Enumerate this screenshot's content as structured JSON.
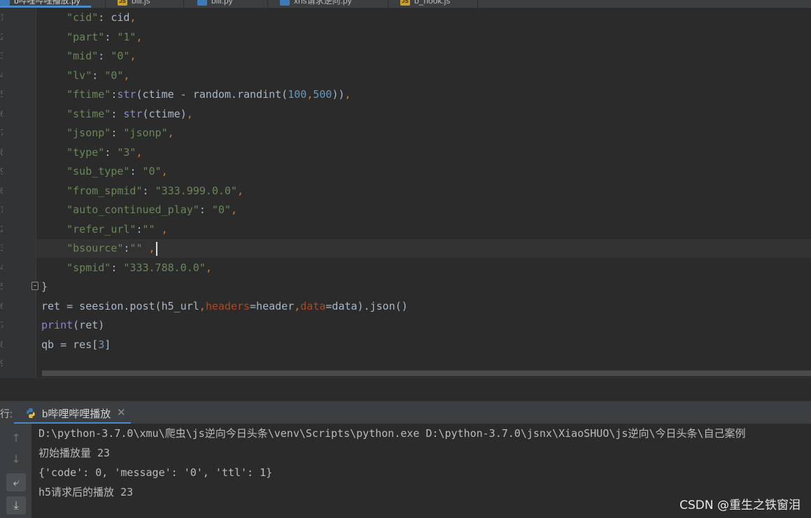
{
  "tabs": [
    {
      "label": "b哔哩哔哩播放.py",
      "icon": "python-file-icon",
      "active": true
    },
    {
      "label": "bili.js",
      "icon": "js-file-icon",
      "active": false
    },
    {
      "label": "bili.py",
      "icon": "python-file-icon",
      "active": false
    },
    {
      "label": "xhs请求逆向.py",
      "icon": "python-file-icon",
      "active": false
    },
    {
      "label": "b_hook.js",
      "icon": "js-file-icon",
      "active": false
    }
  ],
  "editor": {
    "line_numbers": [
      "1",
      "2",
      "3",
      "4",
      "5",
      "6",
      "7",
      "8",
      "9",
      "0",
      "1",
      "2",
      "3",
      "4",
      "5",
      "6",
      "7",
      "8",
      "9"
    ],
    "current_line_index": 12,
    "lines": [
      [
        {
          "t": "    "
        },
        {
          "t": "\"cid\"",
          "c": "s"
        },
        {
          "t": ": cid"
        },
        {
          "t": ",",
          "c": "k"
        }
      ],
      [
        {
          "t": "    "
        },
        {
          "t": "\"part\"",
          "c": "s"
        },
        {
          "t": ": "
        },
        {
          "t": "\"1\"",
          "c": "s"
        },
        {
          "t": ",",
          "c": "k"
        }
      ],
      [
        {
          "t": "    "
        },
        {
          "t": "\"mid\"",
          "c": "s"
        },
        {
          "t": ": "
        },
        {
          "t": "\"0\"",
          "c": "s"
        },
        {
          "t": ",",
          "c": "k"
        }
      ],
      [
        {
          "t": "    "
        },
        {
          "t": "\"lv\"",
          "c": "s"
        },
        {
          "t": ": "
        },
        {
          "t": "\"0\"",
          "c": "s"
        },
        {
          "t": ",",
          "c": "k"
        }
      ],
      [
        {
          "t": "    "
        },
        {
          "t": "\"ftime\"",
          "c": "s"
        },
        {
          "t": ":"
        },
        {
          "t": "str",
          "c": "b"
        },
        {
          "t": "(ctime - random.randint("
        },
        {
          "t": "100",
          "c": "n"
        },
        {
          "t": ",",
          "c": "k"
        },
        {
          "t": "500",
          "c": "n"
        },
        {
          "t": "))"
        },
        {
          "t": ",",
          "c": "k"
        }
      ],
      [
        {
          "t": "    "
        },
        {
          "t": "\"stime\"",
          "c": "s"
        },
        {
          "t": ": "
        },
        {
          "t": "str",
          "c": "b"
        },
        {
          "t": "(ctime)"
        },
        {
          "t": ",",
          "c": "k"
        }
      ],
      [
        {
          "t": "    "
        },
        {
          "t": "\"jsonp\"",
          "c": "s"
        },
        {
          "t": ": "
        },
        {
          "t": "\"jsonp\"",
          "c": "s"
        },
        {
          "t": ",",
          "c": "k"
        }
      ],
      [
        {
          "t": "    "
        },
        {
          "t": "\"type\"",
          "c": "s"
        },
        {
          "t": ": "
        },
        {
          "t": "\"3\"",
          "c": "s"
        },
        {
          "t": ",",
          "c": "k"
        }
      ],
      [
        {
          "t": "    "
        },
        {
          "t": "\"sub_type\"",
          "c": "s"
        },
        {
          "t": ": "
        },
        {
          "t": "\"0\"",
          "c": "s"
        },
        {
          "t": ",",
          "c": "k"
        }
      ],
      [
        {
          "t": "    "
        },
        {
          "t": "\"from_spmid\"",
          "c": "s"
        },
        {
          "t": ": "
        },
        {
          "t": "\"333.999.0.0\"",
          "c": "s"
        },
        {
          "t": ",",
          "c": "k"
        }
      ],
      [
        {
          "t": "    "
        },
        {
          "t": "\"auto_continued_play\"",
          "c": "s"
        },
        {
          "t": ": "
        },
        {
          "t": "\"0\"",
          "c": "s"
        },
        {
          "t": ",",
          "c": "k"
        }
      ],
      [
        {
          "t": "    "
        },
        {
          "t": "\"refer_url\"",
          "c": "s"
        },
        {
          "t": ":"
        },
        {
          "t": "\"\"",
          "c": "s"
        },
        {
          "t": " "
        },
        {
          "t": ",",
          "c": "k"
        }
      ],
      [
        {
          "t": "    "
        },
        {
          "t": "\"bsource\"",
          "c": "s"
        },
        {
          "t": ":"
        },
        {
          "t": "\"\"",
          "c": "s"
        },
        {
          "t": " "
        },
        {
          "t": ",",
          "c": "k"
        },
        {
          "caret": true
        }
      ],
      [
        {
          "t": "    "
        },
        {
          "t": "\"spmid\"",
          "c": "s"
        },
        {
          "t": ": "
        },
        {
          "t": "\"333.788.0.0\"",
          "c": "s"
        },
        {
          "t": ",",
          "c": "k"
        }
      ],
      [
        {
          "t": "}"
        }
      ],
      [
        {
          "t": "ret = seesion.post(h5_url"
        },
        {
          "t": ",",
          "c": "k"
        },
        {
          "t": "headers",
          "c": "p"
        },
        {
          "t": "=header"
        },
        {
          "t": ",",
          "c": "k"
        },
        {
          "t": "data",
          "c": "p"
        },
        {
          "t": "=data).json()"
        }
      ],
      [
        {
          "t": "print",
          "c": "b"
        },
        {
          "t": "(ret)"
        }
      ],
      [
        {
          "t": "qb = res["
        },
        {
          "t": "3",
          "c": "n"
        },
        {
          "t": "]"
        }
      ],
      [
        {
          "t": ""
        }
      ]
    ]
  },
  "run": {
    "label": "行:",
    "tab_label": "b哔哩哔哩播放",
    "tab_icon": "python-icon",
    "close_glyph": "✕",
    "toolbar": [
      {
        "name": "up-arrow-icon",
        "glyph": "↑"
      },
      {
        "name": "down-arrow-icon",
        "glyph": "↓"
      },
      {
        "name": "soft-wrap-icon",
        "glyph": "⤶"
      },
      {
        "name": "scroll-to-end-icon",
        "glyph": "⤓"
      }
    ],
    "console_lines": [
      "D:\\python-3.7.0\\xmu\\爬虫\\js逆向今日头条\\venv\\Scripts\\python.exe D:\\python-3.7.0\\jsnx\\XiaoSHUO\\js逆向\\今日头条\\自己案例",
      "初始播放量 23",
      "{'code': 0, 'message': '0', 'ttl': 1}",
      "h5请求后的播放 23"
    ]
  },
  "watermark": "CSDN @重生之铁窗泪",
  "colors": {
    "editor_bg": "#2b2b2b",
    "string": "#6a8759",
    "keyword": "#cc7832",
    "number": "#6897bb",
    "builtin": "#8888c6",
    "param": "#aa4926",
    "accent": "#4a88c7"
  }
}
